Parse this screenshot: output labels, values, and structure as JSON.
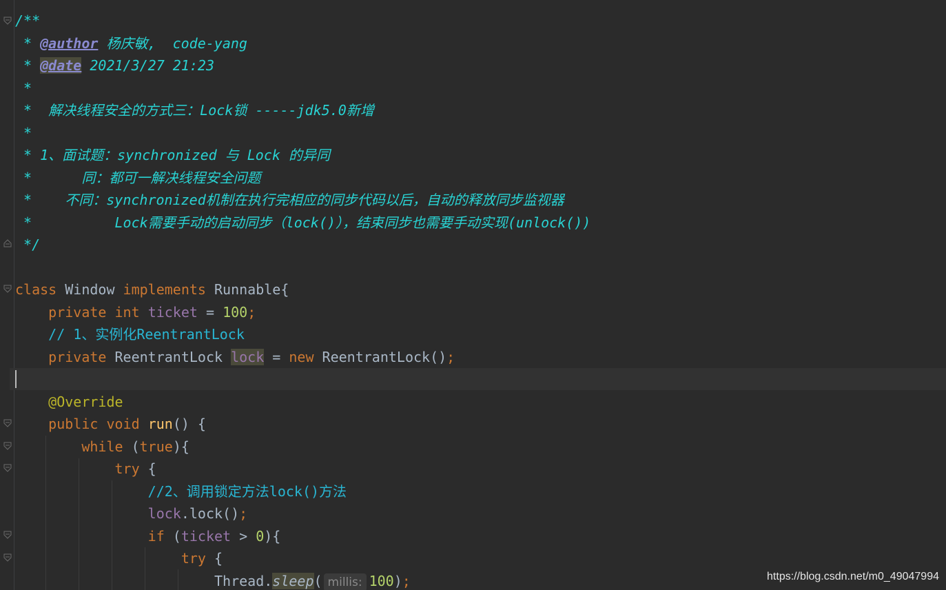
{
  "editor": {
    "lines": {
      "l1": "/**",
      "l2_prefix": " * ",
      "l2_tag": "@author",
      "l2_text": " 杨庆敏,  code-yang",
      "l3_prefix": " * ",
      "l3_tag": "@date",
      "l3_text": " 2021/3/27 21:23",
      "l4": " *",
      "l5": " *  解决线程安全的方式三：Lock锁 -----jdk5.0新增",
      "l6": " *",
      "l7": " * 1、面试题：synchronized 与 Lock 的异同",
      "l8": " *      同：都可一解决线程安全问题",
      "l9": " *    不同：synchronized机制在执行完相应的同步代码以后，自动的释放同步监视器",
      "l10": " *          Lock需要手动的启动同步（lock()），结束同步也需要手动实现(unlock())",
      "l11": " */",
      "l13_kw1": "class",
      "l13_name": " Window ",
      "l13_kw2": "implements",
      "l13_rest": " Runnable{",
      "l14_kw": "private",
      "l14_kw2": "int",
      "l14_field": "ticket",
      "l14_eq": " = ",
      "l14_num": "100",
      "l14_semi": ";",
      "l15": "// 1、实例化ReentrantLock",
      "l16_kw": "private",
      "l16_type": " ReentrantLock ",
      "l16_field": "lock",
      "l16_eq": " = ",
      "l16_new": "new",
      "l16_rest": " ReentrantLock()",
      "l16_semi": ";",
      "l18": "@Override",
      "l19_kw": "public",
      "l19_kw2": "void",
      "l19_method": "run",
      "l19_rest": "() {",
      "l20_kw": "while",
      "l20_open": " (",
      "l20_true": "true",
      "l20_rest": "){",
      "l21_kw": "try",
      "l21_rest": " {",
      "l22": "//2、调用锁定方法lock()方法",
      "l23_field": "lock",
      "l23_rest": ".lock()",
      "l23_semi": ";",
      "l24_kw": "if",
      "l24_open": " (",
      "l24_field": "ticket",
      "l24_op": " > ",
      "l24_num": "0",
      "l24_rest": "){",
      "l25_kw": "try",
      "l25_rest": " {",
      "l26_cls": "Thread.",
      "l26_method": "sleep",
      "l26_open": "(",
      "l26_hint": "millis:",
      "l26_num": "100",
      "l26_close": ")",
      "l26_semi": ";"
    }
  },
  "watermark": "https://blog.csdn.net/m0_49047994"
}
